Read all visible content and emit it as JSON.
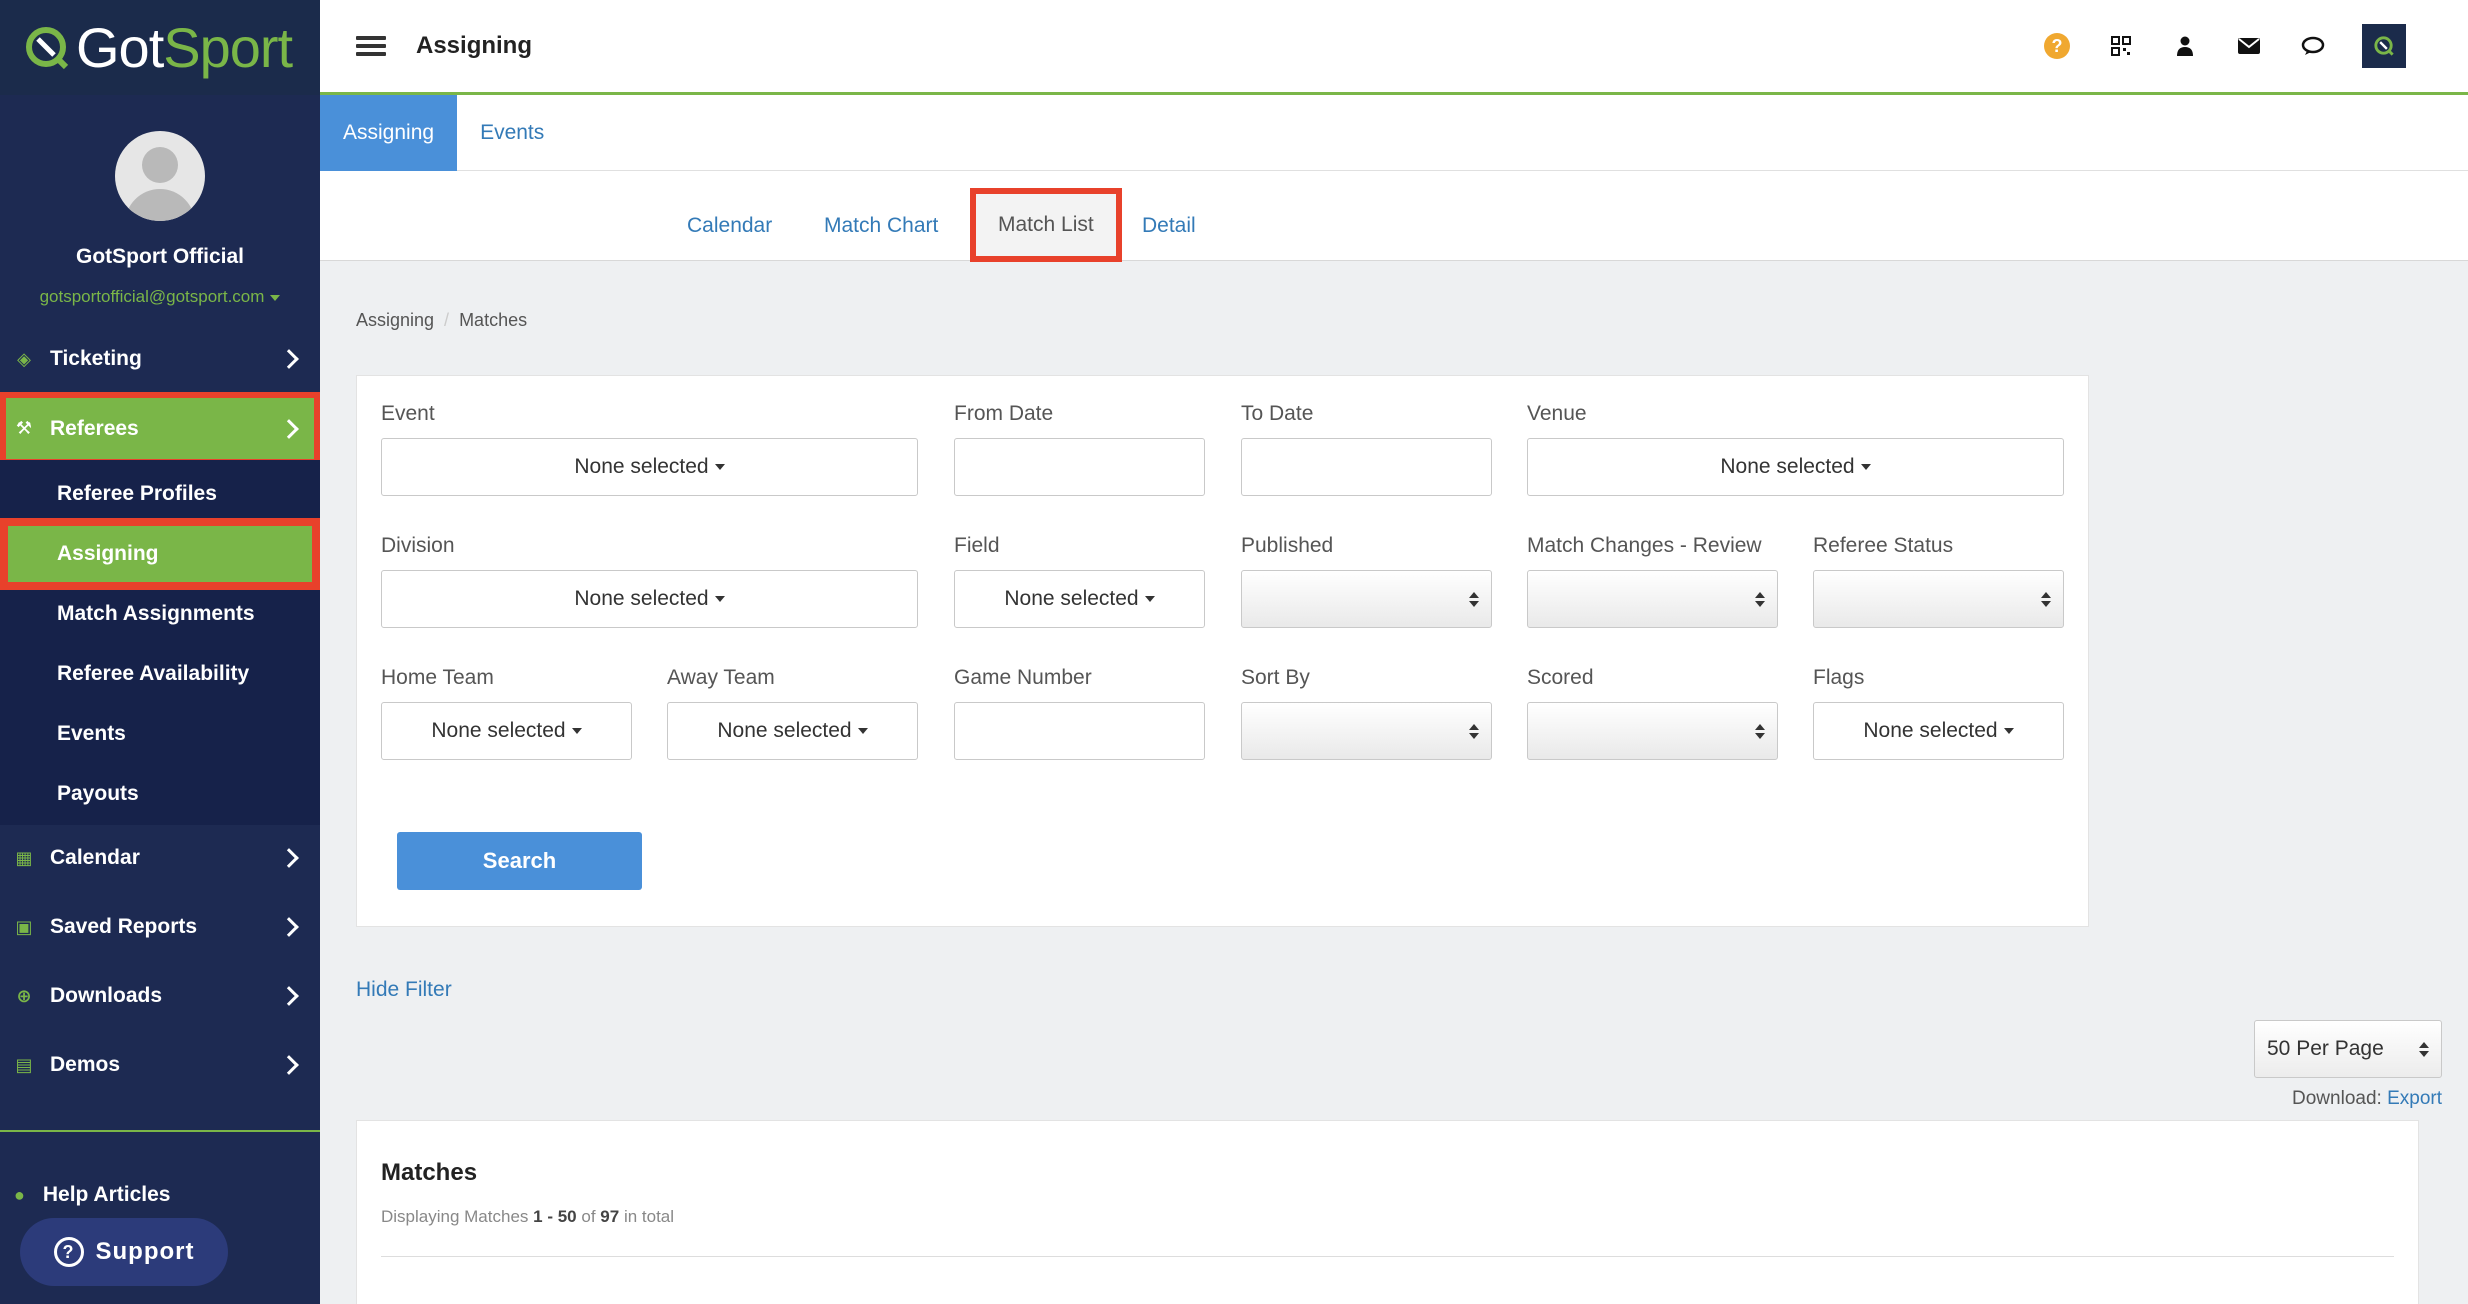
{
  "brand": {
    "name_part1": "Got",
    "name_part2": "Sport",
    "accent": "#7ab648",
    "navy": "#1d2a52",
    "highlight": "#e8412b"
  },
  "profile": {
    "name": "GotSport Official",
    "email": "gotsportofficial@gotsport.com"
  },
  "sidebar": {
    "items": [
      {
        "label": "Ticketing",
        "icon": "ticket-icon"
      },
      {
        "label": "Referees",
        "icon": "gavel-icon"
      },
      {
        "label": "Calendar",
        "icon": "calendar-icon"
      },
      {
        "label": "Saved Reports",
        "icon": "save-icon"
      },
      {
        "label": "Downloads",
        "icon": "download-icon"
      },
      {
        "label": "Demos",
        "icon": "file-icon"
      }
    ],
    "submenu": [
      {
        "label": "Referee Profiles"
      },
      {
        "label": "Assigning"
      },
      {
        "label": "Match Assignments"
      },
      {
        "label": "Referee Availability"
      },
      {
        "label": "Events"
      },
      {
        "label": "Payouts"
      }
    ],
    "help_label": "Help Articles",
    "support_label": "Support"
  },
  "header": {
    "title": "Assigning"
  },
  "tabs_primary": [
    "Assigning",
    "Events"
  ],
  "tabs_secondary": [
    "Calendar",
    "Match Chart",
    "Match List",
    "Detail"
  ],
  "breadcrumb": [
    "Assigning",
    "Matches"
  ],
  "filters": {
    "event": {
      "label": "Event",
      "value": "None selected"
    },
    "from_date": {
      "label": "From Date",
      "value": ""
    },
    "to_date": {
      "label": "To Date",
      "value": ""
    },
    "venue": {
      "label": "Venue",
      "value": "None selected"
    },
    "division": {
      "label": "Division",
      "value": "None selected"
    },
    "field": {
      "label": "Field",
      "value": "None selected"
    },
    "published": {
      "label": "Published",
      "value": ""
    },
    "match_changes": {
      "label": "Match Changes - Review",
      "value": ""
    },
    "referee_status": {
      "label": "Referee Status",
      "value": ""
    },
    "home_team": {
      "label": "Home Team",
      "value": "None selected"
    },
    "away_team": {
      "label": "Away Team",
      "value": "None selected"
    },
    "game_number": {
      "label": "Game Number",
      "value": ""
    },
    "sort_by": {
      "label": "Sort By",
      "value": ""
    },
    "scored": {
      "label": "Scored",
      "value": ""
    },
    "flags": {
      "label": "Flags",
      "value": "None selected"
    },
    "search_label": "Search"
  },
  "hide_filter_label": "Hide Filter",
  "per_page": "50 Per Page",
  "download": {
    "label": "Download:",
    "link": "Export"
  },
  "matches": {
    "title": "Matches",
    "info_prefix": "Displaying Matches",
    "range": "1 - 50",
    "of_label": "of",
    "total": "97",
    "suffix": "in total"
  }
}
